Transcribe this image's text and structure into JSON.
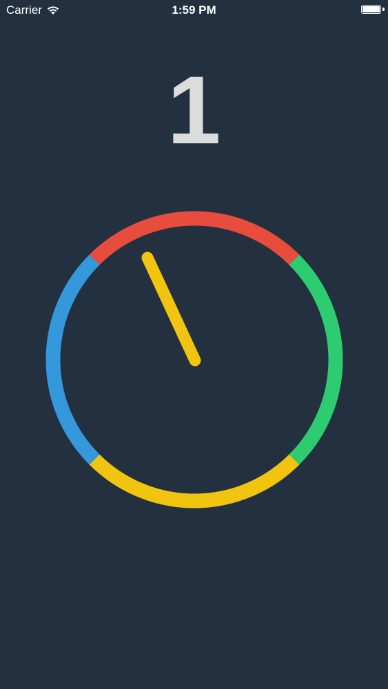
{
  "status_bar": {
    "carrier": "Carrier",
    "time": "1:59 PM",
    "wifi_icon": "wifi-icon",
    "battery_icon": "battery-icon",
    "battery_level": 1.0
  },
  "game": {
    "score": "1",
    "background_color": "#233040",
    "score_color": "#dcdcdc",
    "ring_segments": [
      {
        "name": "red",
        "color": "#e74c3c"
      },
      {
        "name": "green",
        "color": "#2ecc71"
      },
      {
        "name": "yellow",
        "color": "#f1c40f"
      },
      {
        "name": "blue",
        "color": "#3498db"
      }
    ],
    "needle_color": "#f1c40f"
  }
}
